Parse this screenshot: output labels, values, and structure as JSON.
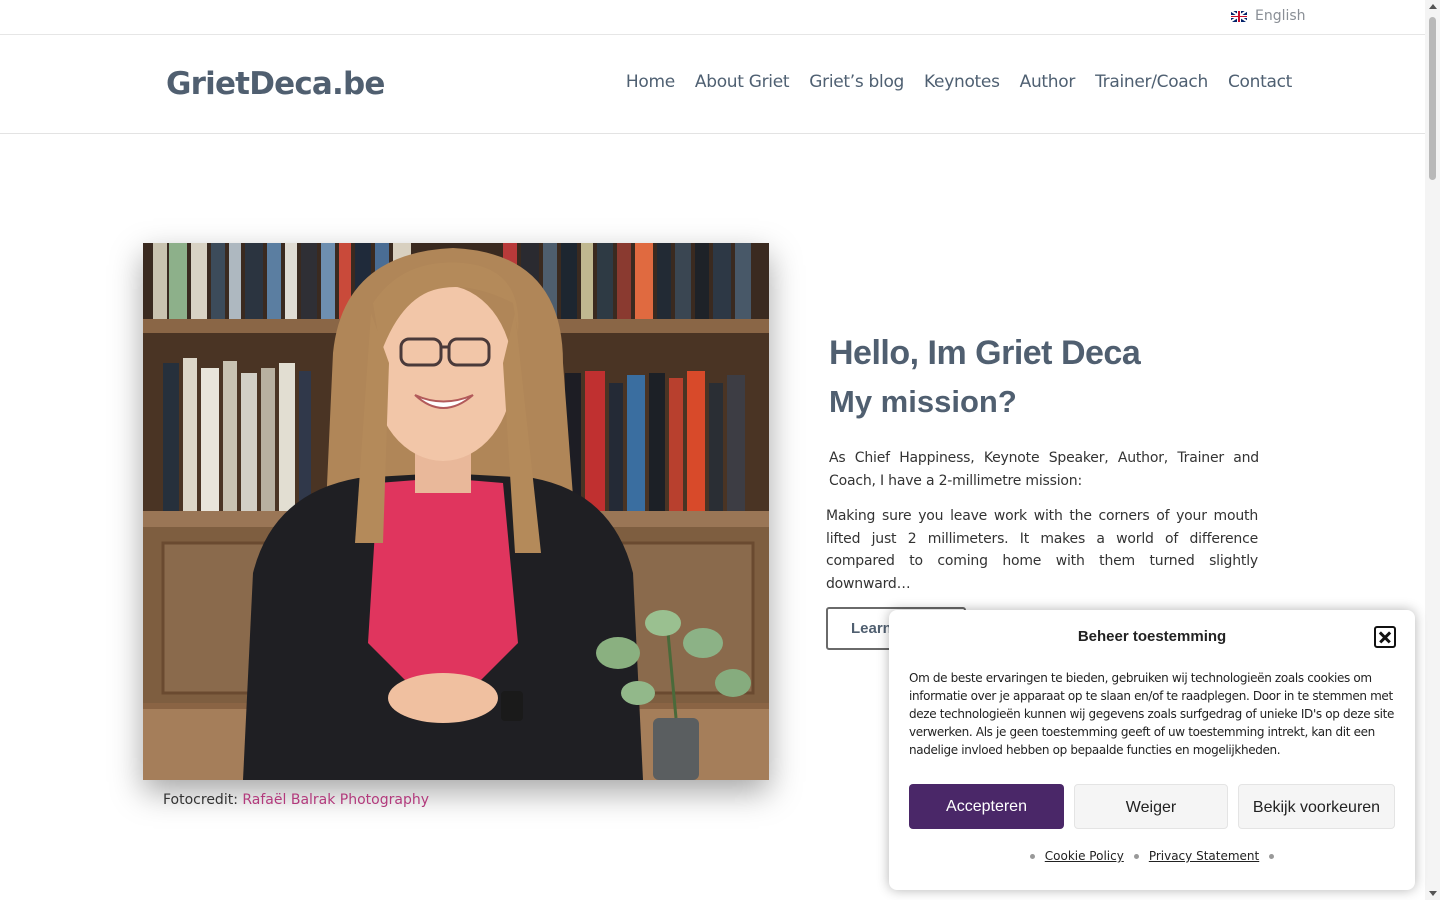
{
  "language": {
    "label": "English",
    "flag_icon": "uk-flag-icon"
  },
  "site": {
    "logo": "GrietDeca.be"
  },
  "nav": {
    "items": [
      {
        "label": "Home"
      },
      {
        "label": "About Griet"
      },
      {
        "label": "Griet’s blog"
      },
      {
        "label": "Keynotes"
      },
      {
        "label": "Author"
      },
      {
        "label": "Trainer/Coach"
      },
      {
        "label": "Contact"
      }
    ]
  },
  "hero": {
    "title": "Hello, Im Griet Deca",
    "subtitle": "My mission?",
    "paragraph1": "As Chief Happiness, Keynote Speaker, Author, Trainer and Coach, I have a 2-millimetre mission:",
    "paragraph2": "Making sure you leave work with the corners of your mouth lifted just 2 millimeters. It makes a world of difference compared to coming home with them turned slightly downward…",
    "button_label": "Learn"
  },
  "photo": {
    "credit_label": "Fotocredit:",
    "credit_link": "Rafaël Balrak Photography"
  },
  "consent": {
    "title": "Beheer toestemming",
    "text": "Om de beste ervaringen te bieden, gebruiken wij technologieën zoals cookies om informatie over je apparaat op te slaan en/of te raadplegen. Door in te stemmen met deze technologieën kunnen wij gegevens zoals surfgedrag of unieke ID's op deze site verwerken. Als je geen toestemming geeft of uw toestemming intrekt, kan dit een nadelige invloed hebben op bepaalde functies en mogelijkheden.",
    "accept_label": "Accepteren",
    "deny_label": "Weiger",
    "prefs_label": "Bekijk voorkeuren",
    "cookie_policy": "Cookie Policy",
    "privacy_statement": "Privacy Statement"
  },
  "colors": {
    "brand_text": "#505f70",
    "accept_button": "#4a2768",
    "credit_link": "#b23a7c"
  }
}
